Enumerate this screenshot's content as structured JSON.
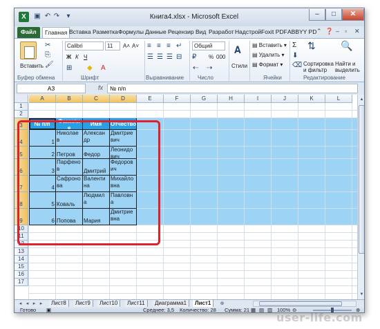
{
  "window": {
    "title": "Книга4.xlsx - Microsoft Excel",
    "logo": "X",
    "controls": {
      "minimize": "–",
      "maximize": "□",
      "close": "✕"
    }
  },
  "ribbon_tabs": [
    "Файл",
    "Главная",
    "Вставка",
    "Разметка",
    "Формулы",
    "Данные",
    "Рецензир",
    "Вид",
    "Разработ",
    "Надстрой",
    "Foxit PDF",
    "ABBYY PD"
  ],
  "active_ribbon_tab": "Главная",
  "ribbon": {
    "clipboard": {
      "paste": "Вставить",
      "label": "Буфер обмена"
    },
    "font": {
      "name": "Calibri",
      "size": "11",
      "bold": "Ж",
      "italic": "К",
      "underline": "Ч",
      "grow": "A˄",
      "shrink": "A˅",
      "label": "Шрифт"
    },
    "alignment": {
      "label": "Выравнивание"
    },
    "number": {
      "format": "Общий",
      "percent": "%",
      "thousands": "000",
      "label": "Число"
    },
    "styles": {
      "label": "Стили"
    },
    "cells": {
      "insert": "Вставить",
      "delete": "Удалить",
      "format": "Формат",
      "label": "Ячейки"
    },
    "editing": {
      "sigma": "Σ",
      "sort": "Сортировка и фильтр",
      "find": "Найти и выделить",
      "label": "Редактирование"
    }
  },
  "formula_bar": {
    "name_box": "A3",
    "fx": "fx",
    "formula": "№ п/п"
  },
  "columns": [
    "A",
    "B",
    "C",
    "D",
    "E",
    "F",
    "G",
    "H",
    "I",
    "J",
    "K",
    "L"
  ],
  "rows": [
    "1",
    "2",
    "3",
    "4",
    "5",
    "6",
    "7",
    "8",
    "9",
    "10",
    "11",
    "12",
    "13",
    "14",
    "15",
    "16",
    "17"
  ],
  "table": {
    "headers": [
      "№ п/п",
      "Фамили\nя",
      "Имя",
      "Отчество"
    ],
    "rows": [
      [
        "1",
        "Николае\nв",
        "Алексан\nдр",
        "Дмитрие\nвич"
      ],
      [
        "2",
        "Петров",
        "Федор",
        "Леонидо\nвич"
      ],
      [
        "3",
        "Парфено\nв",
        "Дмитрий",
        "Федоров\nич"
      ],
      [
        "4",
        "Сафроно\nва",
        "Валенти\nна",
        "Михайло\nвна"
      ],
      [
        "5",
        "Коваль",
        "Людмил\nа",
        "Павловн\nа"
      ],
      [
        "6",
        "Попова",
        "Мария",
        "Дмитрие\nвна"
      ]
    ]
  },
  "sheet_tabs": [
    "Лист8",
    "Лист9",
    "Лист10",
    "Лист11",
    "Диаграмма1",
    "Лист1"
  ],
  "active_sheet": "Лист1",
  "status": {
    "ready": "Готово",
    "average": "Среднее: 3,5",
    "count": "Количество: 28",
    "sum": "Сумма: 21",
    "zoom": "100%"
  },
  "watermark": "user-life.com"
}
